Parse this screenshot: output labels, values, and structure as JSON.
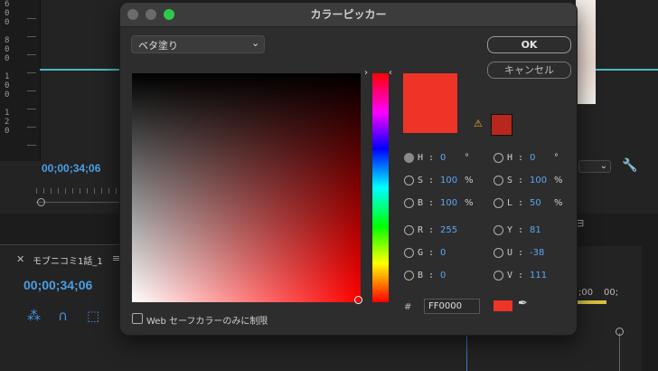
{
  "background": {
    "ruler_digits": [
      "6",
      "0",
      "0",
      "8",
      "0",
      "0",
      "1",
      "0",
      "0",
      "1",
      "2",
      "0"
    ],
    "timecode_top": "00;00;34;06",
    "panel_title": "モブニコミ1話_1",
    "timecode_panel": "00;00;34;06",
    "right_timecodes": ";00",
    "right_timecodes2": "00;"
  },
  "dialog": {
    "title": "カラーピッカー",
    "fill_type": "ベタ塗り",
    "ok_label": "OK",
    "cancel_label": "キャンセル",
    "web_safe_label": "Web セーフカラーのみに制限",
    "hex_prefix": "#",
    "hex_value": "FF0000",
    "selected_hue_color": "#ff0000",
    "new_color": "#ee3327",
    "web_safe_color": "#b8271d",
    "fields_left": [
      {
        "label": "H :",
        "value": "0",
        "unit": "°",
        "selected": true
      },
      {
        "label": "S :",
        "value": "100",
        "unit": "%",
        "selected": false
      },
      {
        "label": "B :",
        "value": "100",
        "unit": "%",
        "selected": false
      },
      {
        "label": "R :",
        "value": "255",
        "unit": "",
        "selected": false
      },
      {
        "label": "G :",
        "value": "0",
        "unit": "",
        "selected": false
      },
      {
        "label": "B :",
        "value": "0",
        "unit": "",
        "selected": false
      }
    ],
    "fields_right": [
      {
        "label": "H :",
        "value": "0",
        "unit": "°",
        "selected": false
      },
      {
        "label": "S :",
        "value": "100",
        "unit": "%",
        "selected": false
      },
      {
        "label": "L :",
        "value": "50",
        "unit": "%",
        "selected": false
      },
      {
        "label": "Y :",
        "value": "81",
        "unit": "",
        "selected": false
      },
      {
        "label": "U :",
        "value": "-38",
        "unit": "",
        "selected": false
      },
      {
        "label": "V :",
        "value": "111",
        "unit": "",
        "selected": false
      }
    ]
  }
}
